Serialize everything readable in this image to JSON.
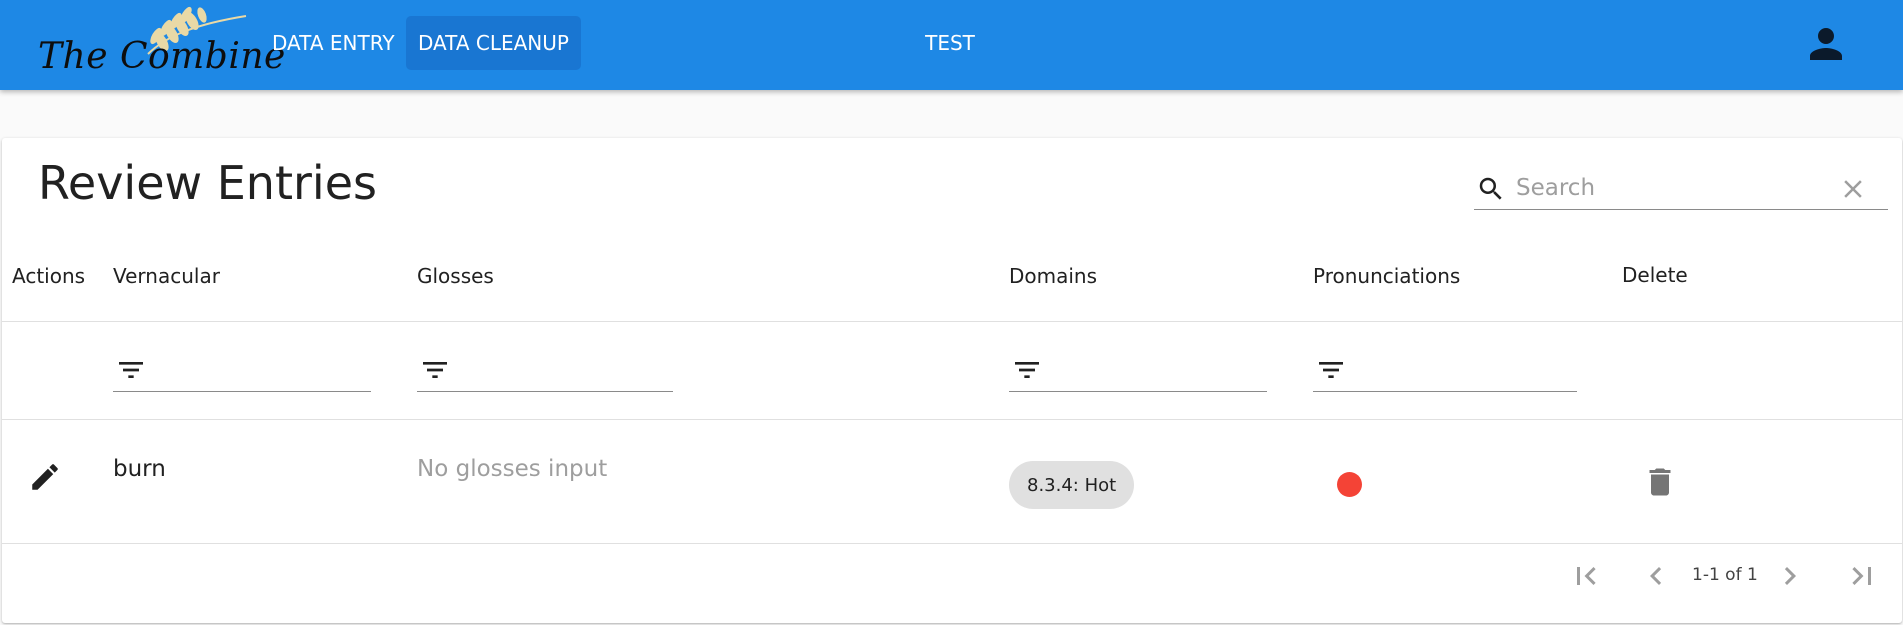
{
  "appbar": {
    "logo_text": "The Combine",
    "nav": [
      {
        "label": "DATA ENTRY",
        "active": false
      },
      {
        "label": "DATA CLEANUP",
        "active": true
      }
    ],
    "project_name": "TEST",
    "user_icon": "account-icon",
    "color": "#1e88e5"
  },
  "page": {
    "title": "Review Entries",
    "search": {
      "placeholder": "Search",
      "value": ""
    }
  },
  "table": {
    "columns": [
      "Actions",
      "Vernacular",
      "Glosses",
      "Domains",
      "Pronunciations",
      "Delete"
    ],
    "rows": [
      {
        "vernacular": "burn",
        "glosses": "No glosses input",
        "domains": [
          "8.3.4: Hot"
        ],
        "pronunciation_color": "#f44336"
      }
    ]
  },
  "pagination": {
    "range": "1-1 of 1"
  }
}
